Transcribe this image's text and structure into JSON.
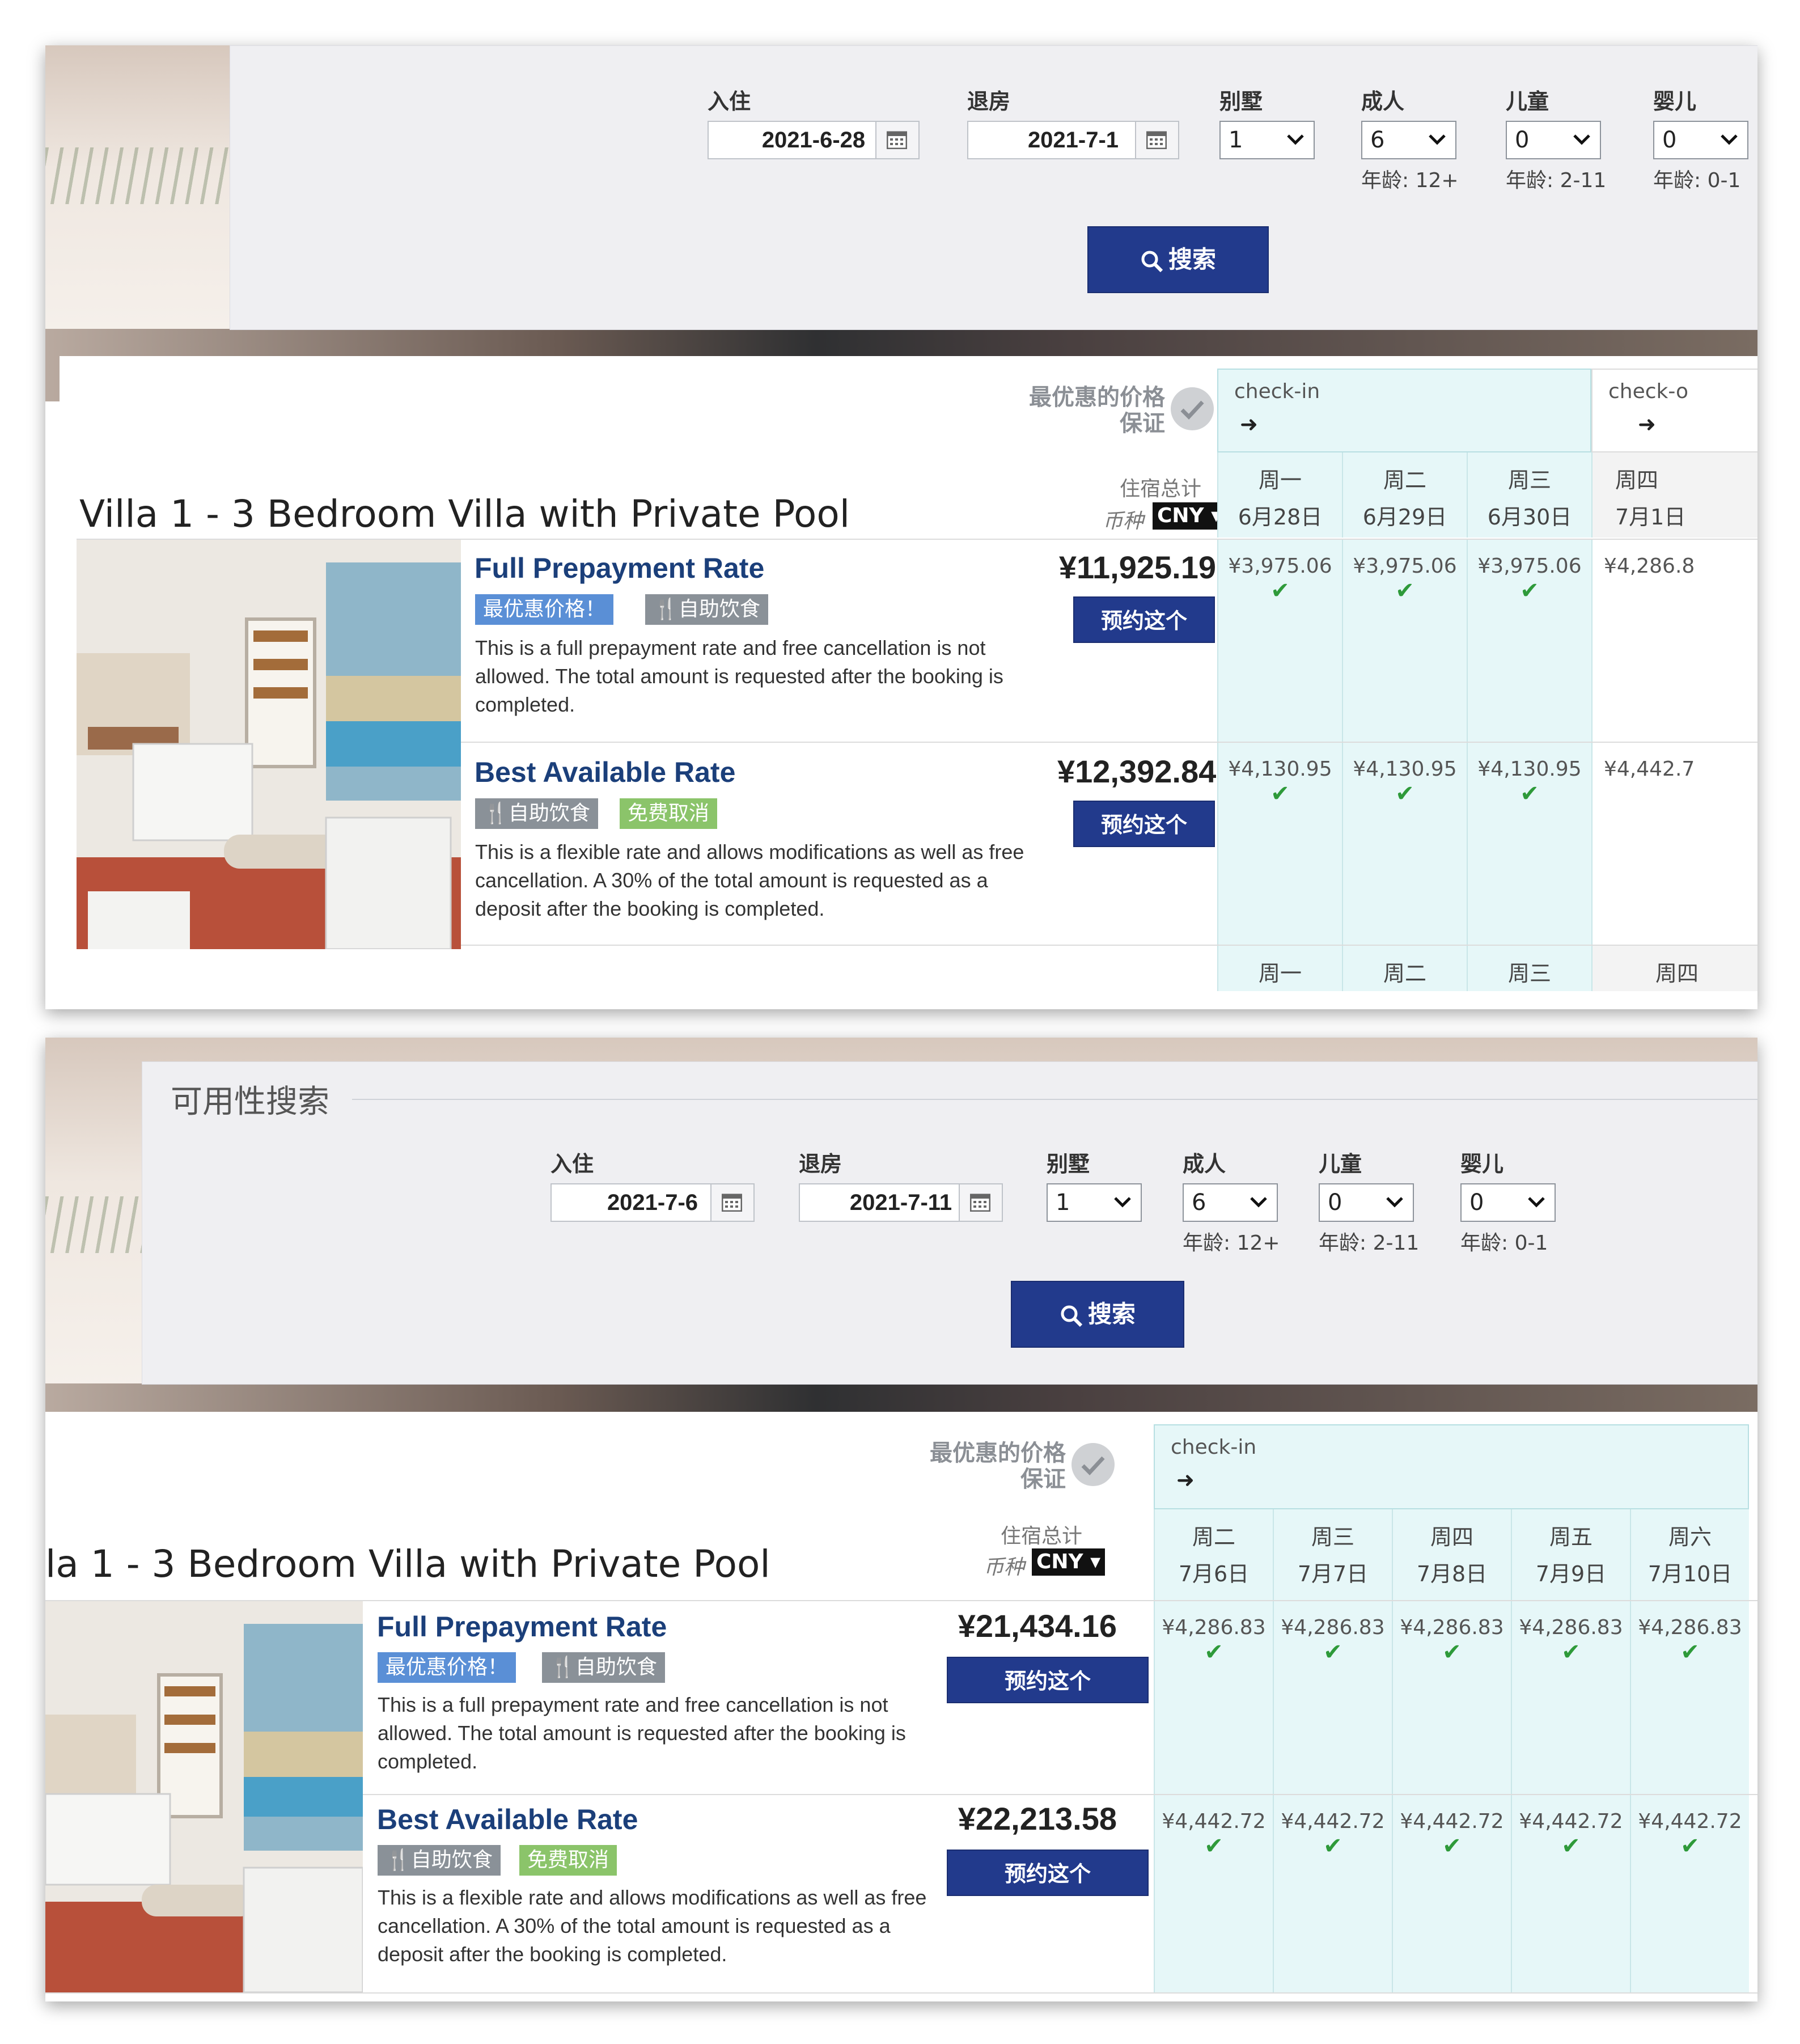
{
  "panel1": {
    "search": {
      "checkin_label": "入住",
      "checkin_value": "2021-6-28",
      "checkout_label": "退房",
      "checkout_value": "2021-7-1",
      "villa_label": "别墅",
      "villa_value": "1",
      "adults_label": "成人",
      "adults_value": "6",
      "adults_age": "年龄: 12+",
      "children_label": "儿童",
      "children_value": "0",
      "children_age": "年龄: 2-11",
      "infants_label": "婴儿",
      "infants_value": "0",
      "infants_age": "年龄: 0-1",
      "search_button": "搜索"
    },
    "results": {
      "guarantee_line1": "最优惠的价格",
      "guarantee_line2": "保证",
      "villa_title": "Villa 1 - 3 Bedroom Villa with Private Pool",
      "total_label": "住宿总计",
      "currency_label": "币种",
      "currency": "CNY",
      "checkin_text": "check-in",
      "checkout_text": "check-o",
      "days": [
        {
          "dow": "周一",
          "date": "6月28日"
        },
        {
          "dow": "周二",
          "date": "6月29日"
        },
        {
          "dow": "周三",
          "date": "6月30日"
        },
        {
          "dow": "周四",
          "date": "7月1日"
        }
      ],
      "footer_days": [
        "周一",
        "周二",
        "周三",
        "周四"
      ],
      "rates": [
        {
          "name": "Full Prepayment Rate",
          "tags": [
            "最优惠价格！",
            "自助饮食"
          ],
          "desc": "This is a full prepayment rate and free cancellation is not allowed. The total amount is requested after the booking is completed.",
          "total": "¥11,925.19",
          "book": "预约这个",
          "nightly": [
            "¥3,975.06",
            "¥3,975.06",
            "¥3,975.06",
            "¥4,286.8"
          ]
        },
        {
          "name": "Best Available Rate",
          "tags": [
            "自助饮食",
            "免费取消"
          ],
          "desc": "This is a flexible rate and allows modifications as well as free cancellation. A 30% of the total amount is requested as a deposit after the booking is completed.",
          "total": "¥12,392.84",
          "book": "预约这个",
          "nightly": [
            "¥4,130.95",
            "¥4,130.95",
            "¥4,130.95",
            "¥4,442.7"
          ]
        }
      ]
    }
  },
  "panel2": {
    "search": {
      "legend": "可用性搜索",
      "checkin_label": "入住",
      "checkin_value": "2021-7-6",
      "checkout_label": "退房",
      "checkout_value": "2021-7-11",
      "villa_label": "别墅",
      "villa_value": "1",
      "adults_label": "成人",
      "adults_value": "6",
      "adults_age": "年龄: 12+",
      "children_label": "儿童",
      "children_value": "0",
      "children_age": "年龄: 2-11",
      "infants_label": "婴儿",
      "infants_value": "0",
      "infants_age": "年龄: 0-1",
      "search_button": "搜索"
    },
    "results": {
      "guarantee_line1": "最优惠的价格",
      "guarantee_line2": "保证",
      "villa_title": "la 1 - 3 Bedroom Villa with Private Pool",
      "total_label": "住宿总计",
      "currency_label": "币种",
      "currency": "CNY",
      "checkin_text": "check-in",
      "days": [
        {
          "dow": "周二",
          "date": "7月6日"
        },
        {
          "dow": "周三",
          "date": "7月7日"
        },
        {
          "dow": "周四",
          "date": "7月8日"
        },
        {
          "dow": "周五",
          "date": "7月9日"
        },
        {
          "dow": "周六",
          "date": "7月10日"
        }
      ],
      "rates": [
        {
          "name": "Full Prepayment Rate",
          "tags": [
            "最优惠价格！",
            "自助饮食"
          ],
          "desc": "This is a full prepayment rate and free cancellation is not allowed. The total amount is requested after the booking is completed.",
          "total": "¥21,434.16",
          "book": "预约这个",
          "nightly": [
            "¥4,286.83",
            "¥4,286.83",
            "¥4,286.83",
            "¥4,286.83",
            "¥4,286.83"
          ]
        },
        {
          "name": "Best Available Rate",
          "tags": [
            "自助饮食",
            "免费取消"
          ],
          "desc": "This is a flexible rate and allows modifications as well as free cancellation. A 30% of the total amount is requested as a deposit after the booking is completed.",
          "total": "¥22,213.58",
          "book": "预约这个",
          "nightly": [
            "¥4,442.72",
            "¥4,442.72",
            "¥4,442.72",
            "¥4,442.72",
            "¥4,442.72"
          ]
        }
      ]
    }
  },
  "colors": {
    "primary_button": "#223a8c",
    "rate_title": "#1b3f7a",
    "tag_best_price": "#5a8fd6",
    "tag_buffet": "#8a9198",
    "tag_free_cancel": "#8bc46a",
    "day_column_bg": "#e6f7f8",
    "check_mark": "#2e9a3a"
  },
  "icons": {
    "calendar": "calendar-icon",
    "dropdown": "chevron-down-icon",
    "search": "search-icon",
    "checkin": "sign-in-icon",
    "checkout": "sign-out-icon",
    "available": "check-icon",
    "buffet": "cutlery-icon",
    "guarantee": "seal-check-icon"
  }
}
